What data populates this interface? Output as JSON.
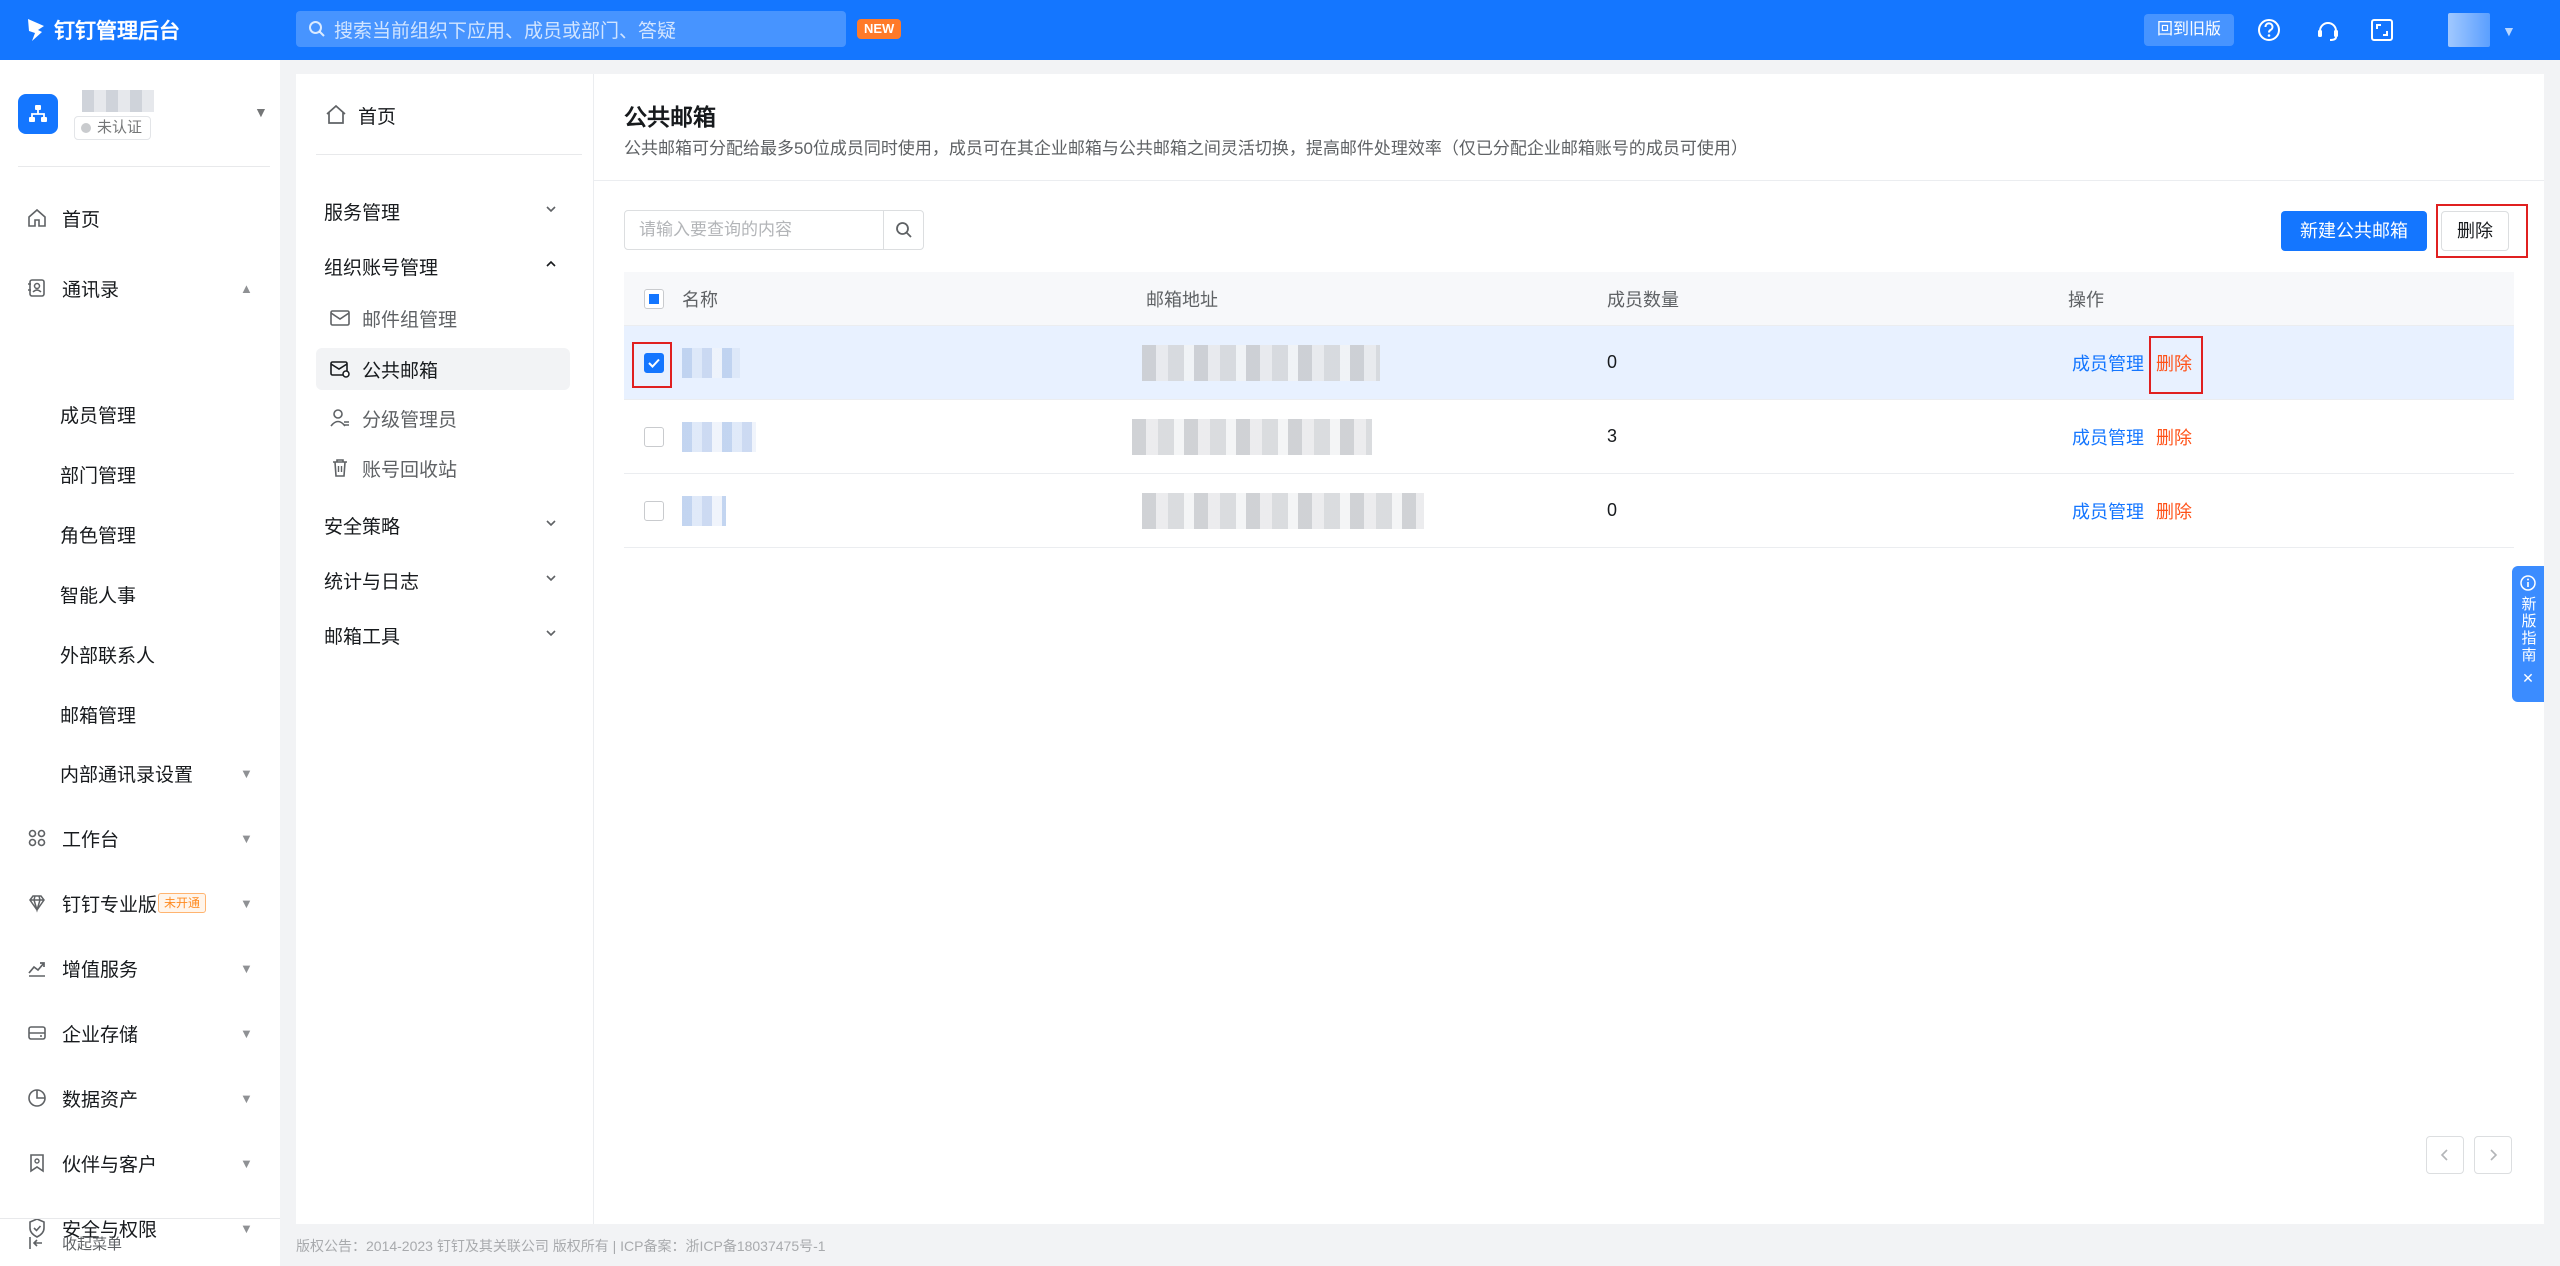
{
  "topbar": {
    "app_title": "钉钉管理后台",
    "search_placeholder": "搜索当前组织下应用、成员或部门、答疑",
    "new_badge": "NEW",
    "old_version_label": "回到旧版",
    "brand_color": "#1476ff"
  },
  "org": {
    "status_badge": "未认证"
  },
  "sidebar": {
    "home": "首页",
    "contacts": "通讯录",
    "contacts_sub": [
      "成员管理",
      "部门管理",
      "角色管理",
      "智能人事",
      "外部联系人",
      "邮箱管理",
      "内部通讯录设置"
    ],
    "workbench": "工作台",
    "pro": "钉钉专业版",
    "pro_tag": "未开通",
    "value_added": "增值服务",
    "storage": "企业存储",
    "data_assets": "数据资产",
    "partners": "伙伴与客户",
    "security": "安全与权限",
    "collapse": "收起菜单"
  },
  "panel2": {
    "home": "首页",
    "service_mgmt": "服务管理",
    "org_account_mgmt": "组织账号管理",
    "subs": [
      "邮件组管理",
      "公共邮箱",
      "分级管理员",
      "账号回收站"
    ],
    "security_policy": "安全策略",
    "stats_logs": "统计与日志",
    "mail_tools": "邮箱工具"
  },
  "main": {
    "title": "公共邮箱",
    "description": "公共邮箱可分配给最多50位成员同时使用，成员可在其企业邮箱与公共邮箱之间灵活切换，提高邮件处理效率（仅已分配企业邮箱账号的成员可使用）",
    "search_placeholder": "请输入要查询的内容",
    "new_button": "新建公共邮箱",
    "delete_button": "删除",
    "columns": [
      "名称",
      "邮箱地址",
      "成员数量",
      "操作"
    ],
    "rows": [
      {
        "member_count": "0",
        "manage": "成员管理",
        "delete": "删除",
        "selected": true
      },
      {
        "member_count": "3",
        "manage": "成员管理",
        "delete": "删除",
        "selected": false
      },
      {
        "member_count": "0",
        "manage": "成员管理",
        "delete": "删除",
        "selected": false
      }
    ]
  },
  "guide": {
    "label": "新版指南"
  },
  "footer": {
    "text": "版权公告：2014-2023 钉钉及其关联公司 版权所有 | ICP备案：浙ICP备18037475号-1"
  }
}
